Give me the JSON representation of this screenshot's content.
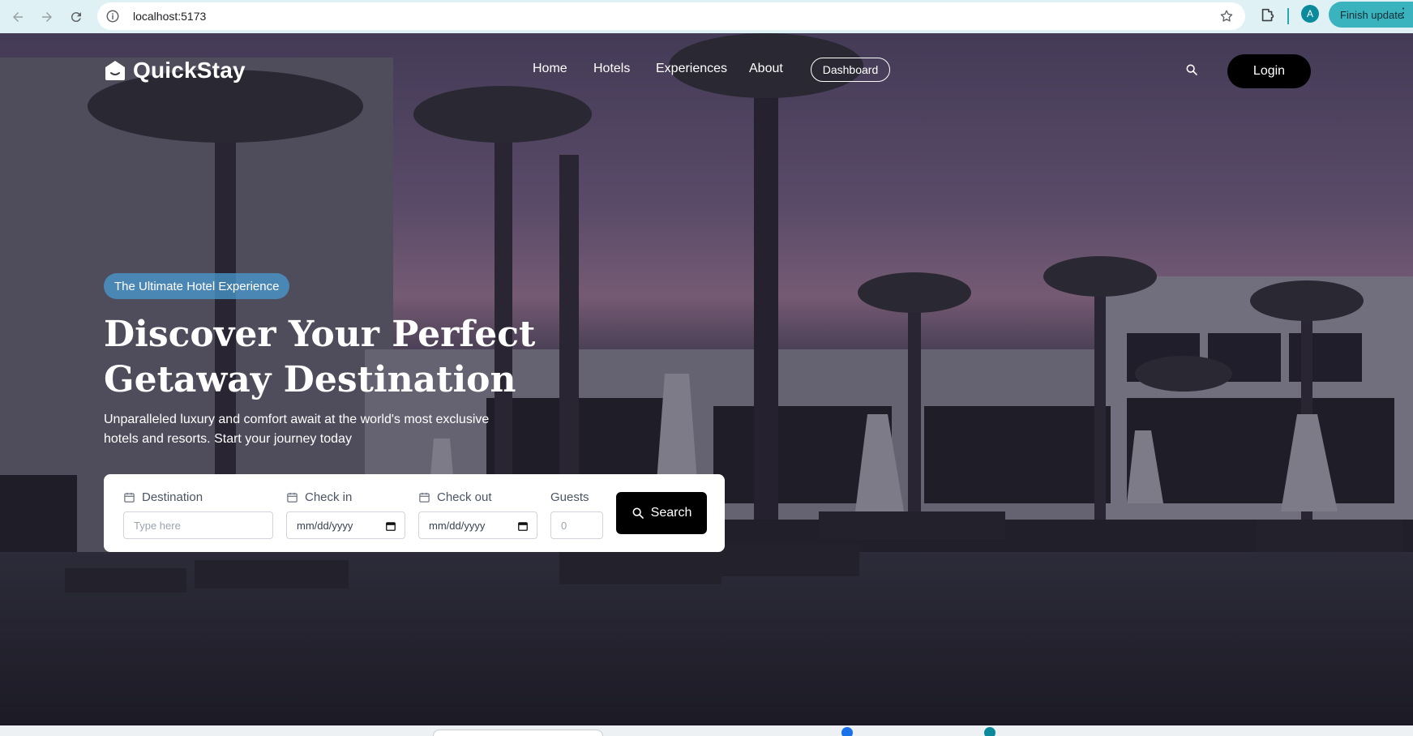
{
  "browser": {
    "url": "localhost:5173",
    "profile_initial": "A",
    "update_label": "Finish update",
    "icons": [
      "back-icon",
      "forward-icon",
      "reload-icon",
      "site-info-icon",
      "bookmark-star-icon",
      "extensions-icon",
      "menu-dots-icon"
    ]
  },
  "site": {
    "brand": "QuickStay",
    "nav": {
      "home": "Home",
      "hotels": "Hotels",
      "experiences": "Experiences",
      "about": "About",
      "dashboard": "Dashboard",
      "login": "Login"
    },
    "hero": {
      "badge": "The Ultimate Hotel Experience",
      "headline": "Discover Your Perfect Getaway Destination",
      "subhead": "Unparalleled luxury and comfort await at the world's most exclusive hotels and resorts. Start your journey today"
    },
    "search_form": {
      "destination_label": "Destination",
      "destination_placeholder": "Type here",
      "checkin_label": "Check in",
      "checkin_value": "mm/dd/yyyy",
      "checkout_label": "Check out",
      "checkout_value": "mm/dd/yyyy",
      "guests_label": "Guests",
      "guests_placeholder": "0",
      "search_button": "Search"
    }
  },
  "colors": {
    "chrome_bg": "#dff1f4",
    "badge_bg": "#499bd2",
    "button_bg": "#000000",
    "accent": "#3ab3bf"
  }
}
